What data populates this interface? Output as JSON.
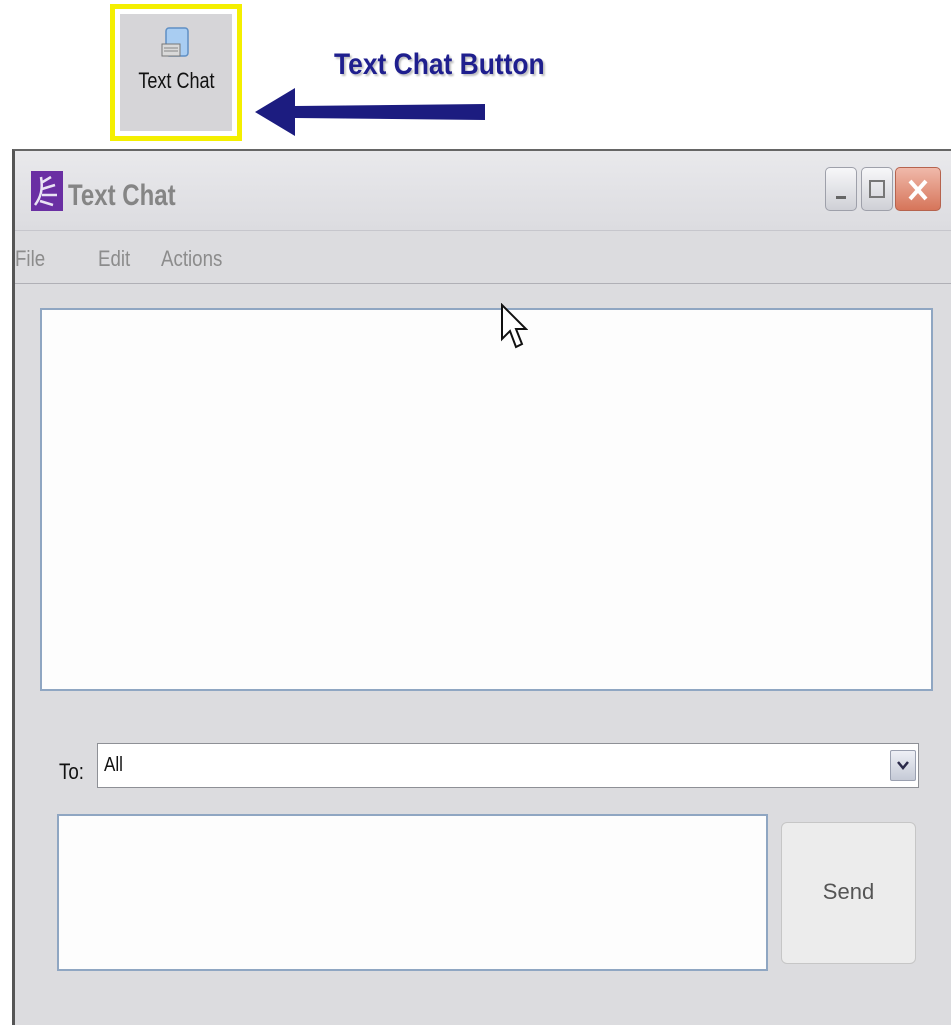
{
  "launcher": {
    "label": "Text Chat"
  },
  "callout": {
    "label": "Text Chat Button"
  },
  "window": {
    "title": "Text Chat",
    "menu": [
      "File",
      "Edit",
      "Actions"
    ]
  },
  "recipient": {
    "label": "To:",
    "value": "All"
  },
  "send": {
    "label": "Send"
  },
  "colors": {
    "highlight": "#f4ef00",
    "callout": "#1f1f8e",
    "close": "#d6755a"
  }
}
